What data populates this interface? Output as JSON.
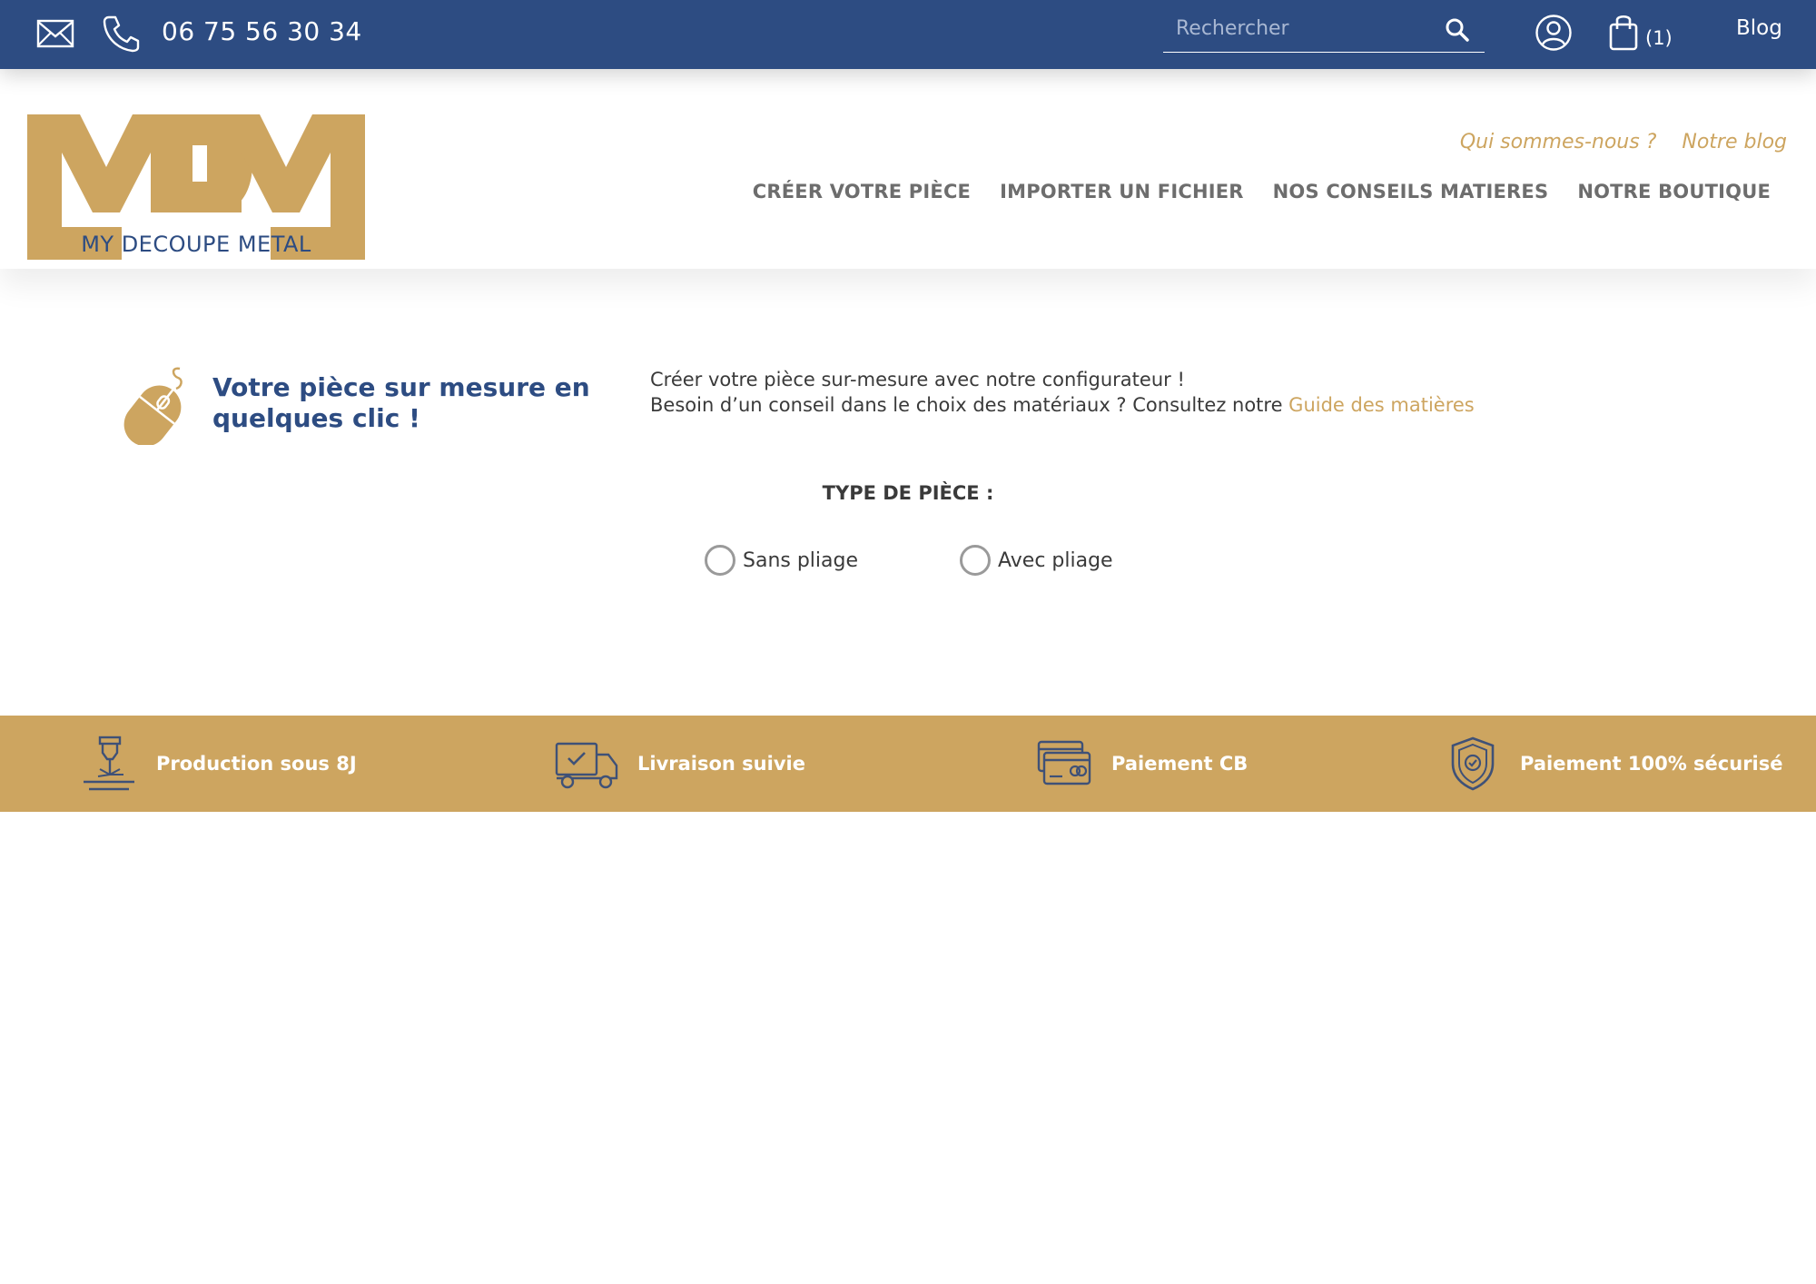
{
  "colors": {
    "navy": "#2d4c82",
    "gold": "#cda560",
    "nav_gray": "#6d6d6d",
    "text_dark": "#3a3a3a"
  },
  "topbar": {
    "mail_icon": "envelope-icon",
    "phone_icon": "phone-icon",
    "phone_number": "06 75 56 30 34",
    "search": {
      "placeholder": "Rechercher",
      "value": "",
      "icon": "search-icon"
    },
    "account_icon": "user-icon",
    "cart": {
      "icon": "shopping-bag-icon",
      "count_label": "(1)"
    },
    "blog_label": "Blog"
  },
  "header": {
    "logo": {
      "letters": "MDM",
      "tagline": "MY DECOUPE METAL"
    },
    "subnav": [
      {
        "label": "Qui sommes-nous ?"
      },
      {
        "label": "Notre blog"
      }
    ],
    "mainnav": [
      {
        "label": "CRÉER VOTRE PIÈCE"
      },
      {
        "label": "IMPORTER UN FICHIER"
      },
      {
        "label": "NOS CONSEILS MATIERES"
      },
      {
        "label": "NOTRE BOUTIQUE"
      }
    ]
  },
  "main": {
    "intro_icon": "computer-mouse-icon",
    "intro_title": "Votre pièce sur mesure en quelques clic !",
    "intro_line1": "Créer votre pièce sur-mesure avec notre configurateur !",
    "intro_line2_prefix": "Besoin d’un conseil dans le choix des matériaux ? Consultez notre ",
    "intro_link": "Guide des matières",
    "type_label": "TYPE DE PIÈCE :",
    "options": [
      {
        "label": "Sans pliage",
        "checked": false
      },
      {
        "label": "Avec pliage",
        "checked": false
      }
    ]
  },
  "band": {
    "items": [
      {
        "icon": "laser-cutter-icon",
        "label": "Production sous 8J"
      },
      {
        "icon": "delivery-truck-icon",
        "label": "Livraison suivie"
      },
      {
        "icon": "credit-card-icon",
        "label": "Paiement CB"
      },
      {
        "icon": "shield-check-icon",
        "label": "Paiement 100% sécurisé"
      }
    ]
  }
}
